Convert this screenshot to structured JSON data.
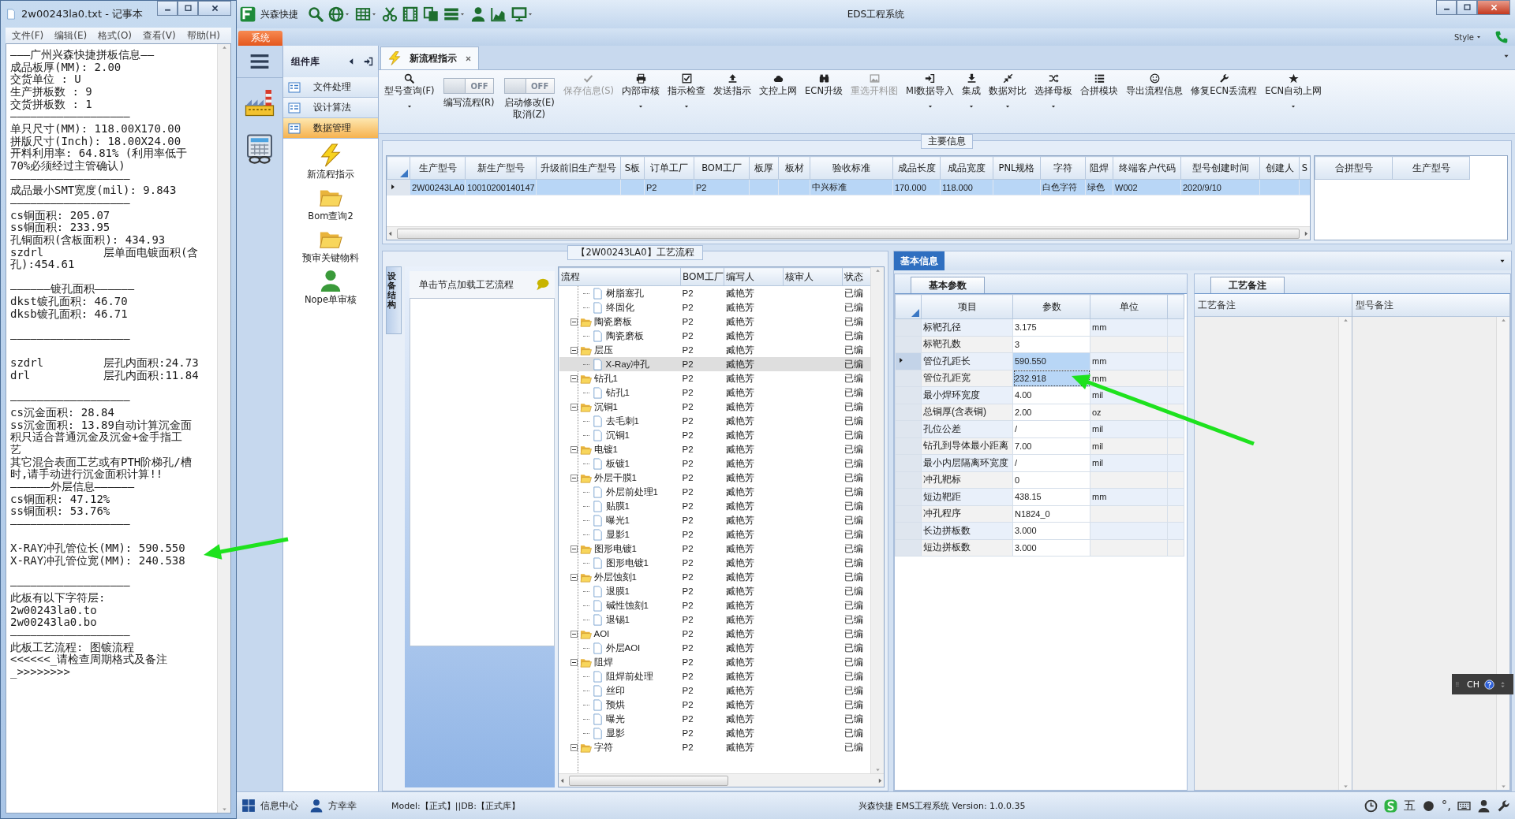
{
  "notepad": {
    "title": "2w00243la0.txt - 记事本",
    "menu": [
      "文件(F)",
      "编辑(E)",
      "格式(O)",
      "查看(V)",
      "帮助(H)"
    ],
    "lines": [
      {
        "kind": "text",
        "text": "———广州兴森快捷拼板信息——"
      },
      {
        "kind": "text",
        "text": "成品板厚(MM): 2.00"
      },
      {
        "kind": "text",
        "text": "交货单位 : U"
      },
      {
        "kind": "text",
        "text": "生产拼板数 : 9"
      },
      {
        "kind": "text",
        "text": "交货拼板数 : 1"
      },
      {
        "kind": "text",
        "text": "——————————————————"
      },
      {
        "kind": "text",
        "text": "单只尺寸(MM): 118.00X170.00"
      },
      {
        "kind": "text",
        "text": "拼版尺寸(Inch): 18.00X24.00"
      },
      {
        "kind": "text",
        "text": "开料利用率: 64.81% (利用率低于"
      },
      {
        "kind": "text",
        "text": "70%必须经过主管确认)"
      },
      {
        "kind": "text",
        "text": "——————————————————"
      },
      {
        "kind": "text",
        "text": "成品最小SMT宽度(mil): 9.843"
      },
      {
        "kind": "text",
        "text": "——————————————————"
      },
      {
        "kind": "text",
        "text": "cs铜面积: 205.07"
      },
      {
        "kind": "text",
        "text": "ss铜面积: 233.95"
      },
      {
        "kind": "text",
        "text": "孔铜面积(含板面积): 434.93"
      },
      {
        "kind": "text",
        "text": "szdrl         层单面电镀面积(含"
      },
      {
        "kind": "text",
        "text": "孔):454.61"
      },
      {
        "kind": "blank"
      },
      {
        "kind": "text",
        "text": "——————镀孔面积——————"
      },
      {
        "kind": "text",
        "text": "dkst镀孔面积: 46.70"
      },
      {
        "kind": "text",
        "text": "dksb镀孔面积: 46.71"
      },
      {
        "kind": "blank"
      },
      {
        "kind": "text",
        "text": "——————————————————"
      },
      {
        "kind": "blank"
      },
      {
        "kind": "text",
        "text": "szdrl         层孔内面积:24.73"
      },
      {
        "kind": "text",
        "text": "drl           层孔内面积:11.84"
      },
      {
        "kind": "blank"
      },
      {
        "kind": "text",
        "text": "——————————————————"
      },
      {
        "kind": "text",
        "text": "cs沉金面积: 28.84"
      },
      {
        "kind": "text",
        "text": "ss沉金面积: 13.89自动计算沉金面"
      },
      {
        "kind": "text",
        "text": "积只适合普通沉金及沉金+金手指工"
      },
      {
        "kind": "text",
        "text": "艺"
      },
      {
        "kind": "text",
        "text": "其它混合表面工艺或有PTH阶梯孔/槽"
      },
      {
        "kind": "text",
        "text": "时,请手动进行沉金面积计算!!"
      },
      {
        "kind": "text",
        "text": "——————外层信息——————"
      },
      {
        "kind": "text",
        "text": "cs铜面积: 47.12%"
      },
      {
        "kind": "text",
        "text": "ss铜面积: 53.76%"
      },
      {
        "kind": "text",
        "text": "——————————————————"
      },
      {
        "kind": "blank"
      },
      {
        "kind": "text",
        "text": "X-RAY冲孔管位长(MM): 590.550"
      },
      {
        "kind": "text",
        "text": "X-RAY冲孔管位宽(MM): 240.538"
      },
      {
        "kind": "blank"
      },
      {
        "kind": "text",
        "text": "——————————————————"
      },
      {
        "kind": "text",
        "text": "此板有以下字符层:"
      },
      {
        "kind": "text",
        "text": "2w00243la0.to"
      },
      {
        "kind": "text",
        "text": "2w00243la0.bo"
      },
      {
        "kind": "text",
        "text": "——————————————————"
      },
      {
        "kind": "text",
        "text": "此板工艺流程: 图镀流程"
      },
      {
        "kind": "text",
        "text": "<<<<<<_请检查周期格式及备注"
      },
      {
        "kind": "text",
        "text": "_>>>>>>>>"
      }
    ]
  },
  "app": {
    "brand": "兴森快捷",
    "title": "EDS工程系统",
    "system_tab": "系统",
    "style_label": "Style",
    "quick_tools": [
      {
        "kind": "search",
        "dropdown": false
      },
      {
        "kind": "globe",
        "dropdown": true
      },
      {
        "kind": "table",
        "dropdown": true
      },
      {
        "kind": "scissors",
        "dropdown": false
      },
      {
        "kind": "film",
        "dropdown": false
      },
      {
        "kind": "copy",
        "dropdown": false
      },
      {
        "kind": "list",
        "dropdown": true
      },
      {
        "kind": "person",
        "dropdown": false
      },
      {
        "kind": "chart",
        "dropdown": false
      },
      {
        "kind": "monitor",
        "dropdown": true
      }
    ]
  },
  "component": {
    "title": "组件库",
    "groups": [
      {
        "label": "文件处理",
        "selected": false
      },
      {
        "label": "设计算法",
        "selected": false
      },
      {
        "label": "数据管理",
        "selected": true
      }
    ],
    "items": [
      {
        "kind": "bolt",
        "label": "新流程指示"
      },
      {
        "kind": "folder",
        "label": "Bom查询2"
      },
      {
        "kind": "folder",
        "label": "预审关键物料"
      },
      {
        "kind": "person",
        "label": "Nope单审核"
      }
    ]
  },
  "tabs": [
    {
      "label": "新流程指示",
      "selected": true
    }
  ],
  "toolbar": [
    {
      "kind": "search",
      "label": "型号查询(F)",
      "dropdown": true,
      "disabled": false
    },
    {
      "kind": "toggle",
      "label": "编写流程(R)",
      "value": "OFF",
      "on": false
    },
    {
      "kind": "toggle",
      "label": "启动修改(E)\n取消(Z)",
      "value": "OFF",
      "on": false
    },
    {
      "kind": "check",
      "label": "保存信息(S)",
      "dropdown": false,
      "disabled": true
    },
    {
      "kind": "printer",
      "label": "内部审核",
      "dropdown": true,
      "disabled": false
    },
    {
      "kind": "checkbox",
      "label": "指示检查",
      "dropdown": true,
      "disabled": false
    },
    {
      "kind": "upload",
      "label": "发送指示",
      "dropdown": false,
      "disabled": false
    },
    {
      "kind": "cloud",
      "label": "文控上网",
      "dropdown": false,
      "disabled": false
    },
    {
      "kind": "binoculars",
      "label": "ECN升级",
      "dropdown": false,
      "disabled": false
    },
    {
      "kind": "image",
      "label": "重选开料图",
      "dropdown": false,
      "disabled": true
    },
    {
      "kind": "import",
      "label": "MI数据导入",
      "dropdown": true,
      "disabled": false
    },
    {
      "kind": "download",
      "label": "集成",
      "dropdown": true,
      "disabled": false
    },
    {
      "kind": "compress",
      "label": "数据对比",
      "dropdown": true,
      "disabled": false
    },
    {
      "kind": "shuffle",
      "label": "选择母板",
      "dropdown": true,
      "disabled": false
    },
    {
      "kind": "listnum",
      "label": "合拼模块",
      "dropdown": false,
      "disabled": false
    },
    {
      "kind": "smile",
      "label": "导出流程信息",
      "dropdown": false,
      "disabled": false
    },
    {
      "kind": "wrench",
      "label": "修复ECN丢流程",
      "dropdown": false,
      "disabled": false
    },
    {
      "kind": "star",
      "label": "ECN自动上网",
      "dropdown": true,
      "disabled": false
    }
  ],
  "main_info": {
    "title": "主要信息",
    "columns": [
      "生产型号",
      "新生产型号",
      "升级前旧生产型号",
      "S板",
      "订单工厂",
      "BOM工厂",
      "板厚",
      "板材",
      "验收标准",
      "成品长度",
      "成品宽度",
      "PNL规格",
      "字符",
      "阻焊",
      "终端客户代码",
      "型号创建时间",
      "创建人",
      "S"
    ],
    "rows": [
      {
        "selected": true,
        "cells": [
          "2W00243LA0",
          "10010200140147",
          null,
          null,
          "P2",
          "P2",
          null,
          null,
          "中兴标准",
          "170.000",
          "118.000",
          null,
          "白色字符",
          "绿色",
          "W002",
          "2020/9/10",
          null,
          null
        ]
      }
    ],
    "side_columns": [
      "合拼型号",
      "生产型号"
    ]
  },
  "process": {
    "title": "【2W00243LA0】工艺流程",
    "side_tab": "设备结构",
    "hint": "单击节点加载工艺流程",
    "columns": [
      "流程",
      "BOM工厂",
      "编写人",
      "核审人",
      "状态"
    ],
    "continued_children": [
      {
        "kind": "doc",
        "label": "树脂塞孔",
        "bom": "P2",
        "writer": "臧艳芳",
        "status": "已编",
        "selected": false
      },
      {
        "kind": "doc",
        "label": "终固化",
        "bom": "P2",
        "writer": "臧艳芳",
        "status": "已编",
        "selected": false
      }
    ],
    "nodes": [
      {
        "kind": "folder",
        "label": "陶瓷磨板",
        "bom": "P2",
        "writer": "臧艳芳",
        "status": "已编",
        "expanded": true,
        "selected": false,
        "children": [
          {
            "kind": "doc",
            "label": "陶瓷磨板",
            "bom": "P2",
            "writer": "臧艳芳",
            "status": "已编",
            "selected": false
          }
        ]
      },
      {
        "kind": "folder",
        "label": "层压",
        "bom": "P2",
        "writer": "臧艳芳",
        "status": "已编",
        "expanded": true,
        "selected": false,
        "children": [
          {
            "kind": "doc",
            "label": "X-Ray冲孔",
            "bom": "P2",
            "writer": "臧艳芳",
            "status": "已编",
            "selected": true
          }
        ]
      },
      {
        "kind": "folder",
        "label": "钻孔1",
        "bom": "P2",
        "writer": "臧艳芳",
        "status": "已编",
        "expanded": true,
        "selected": false,
        "children": [
          {
            "kind": "doc",
            "label": "钻孔1",
            "bom": "P2",
            "writer": "臧艳芳",
            "status": "已编",
            "selected": false
          }
        ]
      },
      {
        "kind": "folder",
        "label": "沉铜1",
        "bom": "P2",
        "writer": "臧艳芳",
        "status": "已编",
        "expanded": true,
        "selected": false,
        "children": [
          {
            "kind": "doc",
            "label": "去毛刺1",
            "bom": "P2",
            "writer": "臧艳芳",
            "status": "已编",
            "selected": false
          },
          {
            "kind": "doc",
            "label": "沉铜1",
            "bom": "P2",
            "writer": "臧艳芳",
            "status": "已编",
            "selected": false
          }
        ]
      },
      {
        "kind": "folder",
        "label": "电镀1",
        "bom": "P2",
        "writer": "臧艳芳",
        "status": "已编",
        "expanded": true,
        "selected": false,
        "children": [
          {
            "kind": "doc",
            "label": "板镀1",
            "bom": "P2",
            "writer": "臧艳芳",
            "status": "已编",
            "selected": false
          }
        ]
      },
      {
        "kind": "folder",
        "label": "外层干膜1",
        "bom": "P2",
        "writer": "臧艳芳",
        "status": "已编",
        "expanded": true,
        "selected": false,
        "children": [
          {
            "kind": "doc",
            "label": "外层前处理1",
            "bom": "P2",
            "writer": "臧艳芳",
            "status": "已编",
            "selected": false
          },
          {
            "kind": "doc",
            "label": "贴膜1",
            "bom": "P2",
            "writer": "臧艳芳",
            "status": "已编",
            "selected": false
          },
          {
            "kind": "doc",
            "label": "曝光1",
            "bom": "P2",
            "writer": "臧艳芳",
            "status": "已编",
            "selected": false
          },
          {
            "kind": "doc",
            "label": "显影1",
            "bom": "P2",
            "writer": "臧艳芳",
            "status": "已编",
            "selected": false
          }
        ]
      },
      {
        "kind": "folder",
        "label": "图形电镀1",
        "bom": "P2",
        "writer": "臧艳芳",
        "status": "已编",
        "expanded": true,
        "selected": false,
        "children": [
          {
            "kind": "doc",
            "label": "图形电镀1",
            "bom": "P2",
            "writer": "臧艳芳",
            "status": "已编",
            "selected": false
          }
        ]
      },
      {
        "kind": "folder",
        "label": "外层蚀刻1",
        "bom": "P2",
        "writer": "臧艳芳",
        "status": "已编",
        "expanded": true,
        "selected": false,
        "children": [
          {
            "kind": "doc",
            "label": "退膜1",
            "bom": "P2",
            "writer": "臧艳芳",
            "status": "已编",
            "selected": false
          },
          {
            "kind": "doc",
            "label": "碱性蚀刻1",
            "bom": "P2",
            "writer": "臧艳芳",
            "status": "已编",
            "selected": false
          },
          {
            "kind": "doc",
            "label": "退锡1",
            "bom": "P2",
            "writer": "臧艳芳",
            "status": "已编",
            "selected": false
          }
        ]
      },
      {
        "kind": "folder",
        "label": "AOI",
        "bom": "P2",
        "writer": "臧艳芳",
        "status": "已编",
        "expanded": true,
        "selected": false,
        "children": [
          {
            "kind": "doc",
            "label": "外层AOI",
            "bom": "P2",
            "writer": "臧艳芳",
            "status": "已编",
            "selected": false
          }
        ]
      },
      {
        "kind": "folder",
        "label": "阻焊",
        "bom": "P2",
        "writer": "臧艳芳",
        "status": "已编",
        "expanded": true,
        "selected": false,
        "children": [
          {
            "kind": "doc",
            "label": "阻焊前处理",
            "bom": "P2",
            "writer": "臧艳芳",
            "status": "已编",
            "selected": false
          },
          {
            "kind": "doc",
            "label": "丝印",
            "bom": "P2",
            "writer": "臧艳芳",
            "status": "已编",
            "selected": false
          },
          {
            "kind": "doc",
            "label": "预烘",
            "bom": "P2",
            "writer": "臧艳芳",
            "status": "已编",
            "selected": false
          },
          {
            "kind": "doc",
            "label": "曝光",
            "bom": "P2",
            "writer": "臧艳芳",
            "status": "已编",
            "selected": false
          },
          {
            "kind": "doc",
            "label": "显影",
            "bom": "P2",
            "writer": "臧艳芳",
            "status": "已编",
            "selected": false
          }
        ]
      },
      {
        "kind": "folder",
        "label": "字符",
        "bom": "P2",
        "writer": "臧艳芳",
        "status": "已编",
        "expanded": true,
        "selected": false
      }
    ]
  },
  "basic_info": {
    "title": "基本信息",
    "tab": "基本参数",
    "columns": [
      "项目",
      "参数",
      "单位"
    ],
    "rows": [
      {
        "item": "标靶孔径",
        "value": "3.175",
        "unit": "mm",
        "current": false,
        "selected": false,
        "focused": false
      },
      {
        "item": "标靶孔数",
        "value": "3",
        "current": false,
        "selected": false,
        "focused": false
      },
      {
        "item": "管位孔距长",
        "value": "590.550",
        "unit": "mm",
        "current": true,
        "selected": true,
        "focused": false
      },
      {
        "item": "管位孔距宽",
        "value": "232.918",
        "unit": "mm",
        "current": false,
        "selected": true,
        "focused": true
      },
      {
        "item": "最小焊环宽度",
        "value": "4.00",
        "unit": "mil",
        "current": false,
        "selected": false,
        "focused": false
      },
      {
        "item": "总铜厚(含表铜)",
        "value": "2.00",
        "unit": "oz",
        "current": false,
        "selected": false,
        "focused": false
      },
      {
        "item": "孔位公差",
        "value": "/",
        "unit": "mil",
        "current": false,
        "selected": false,
        "focused": false
      },
      {
        "item": "钻孔到导体最小距离",
        "value": "7.00",
        "unit": "mil",
        "current": false,
        "selected": false,
        "focused": false
      },
      {
        "item": "最小内层隔离环宽度",
        "value": "/",
        "unit": "mil",
        "current": false,
        "selected": false,
        "focused": false
      },
      {
        "item": "冲孔靶标",
        "value": "0",
        "current": false,
        "selected": false,
        "focused": false
      },
      {
        "item": "短边靶距",
        "value": "438.15",
        "unit": "mm",
        "current": false,
        "selected": false,
        "focused": false
      },
      {
        "item": "冲孔程序",
        "value": "N1824_0",
        "current": false,
        "selected": false,
        "focused": false
      },
      {
        "item": "长边拼板数",
        "value": "3.000",
        "current": false,
        "selected": false,
        "focused": false
      },
      {
        "item": "短边拼板数",
        "value": "3.000",
        "current": false,
        "selected": false,
        "focused": false
      }
    ],
    "notes_tab": "工艺备注",
    "notes_columns": [
      "工艺备注",
      "型号备注"
    ]
  },
  "ime_bar": {
    "label": "CH"
  },
  "status_bar": {
    "items": [
      {
        "kind": "grid",
        "label": "信息中心"
      },
      {
        "kind": "person",
        "label": "方幸幸"
      }
    ],
    "model": "Model:【正式】||DB:【正式库】",
    "version": "兴森快捷 EMS工程系统 Version: 1.0.0.35",
    "tray": [
      {
        "kind": "clock"
      },
      {
        "kind": "logo"
      },
      {
        "kind": "text",
        "label": "五"
      },
      {
        "kind": "dot"
      },
      {
        "kind": "text",
        "label": "°,"
      },
      {
        "kind": "keyboard"
      },
      {
        "kind": "person"
      },
      {
        "kind": "wrench"
      }
    ]
  }
}
